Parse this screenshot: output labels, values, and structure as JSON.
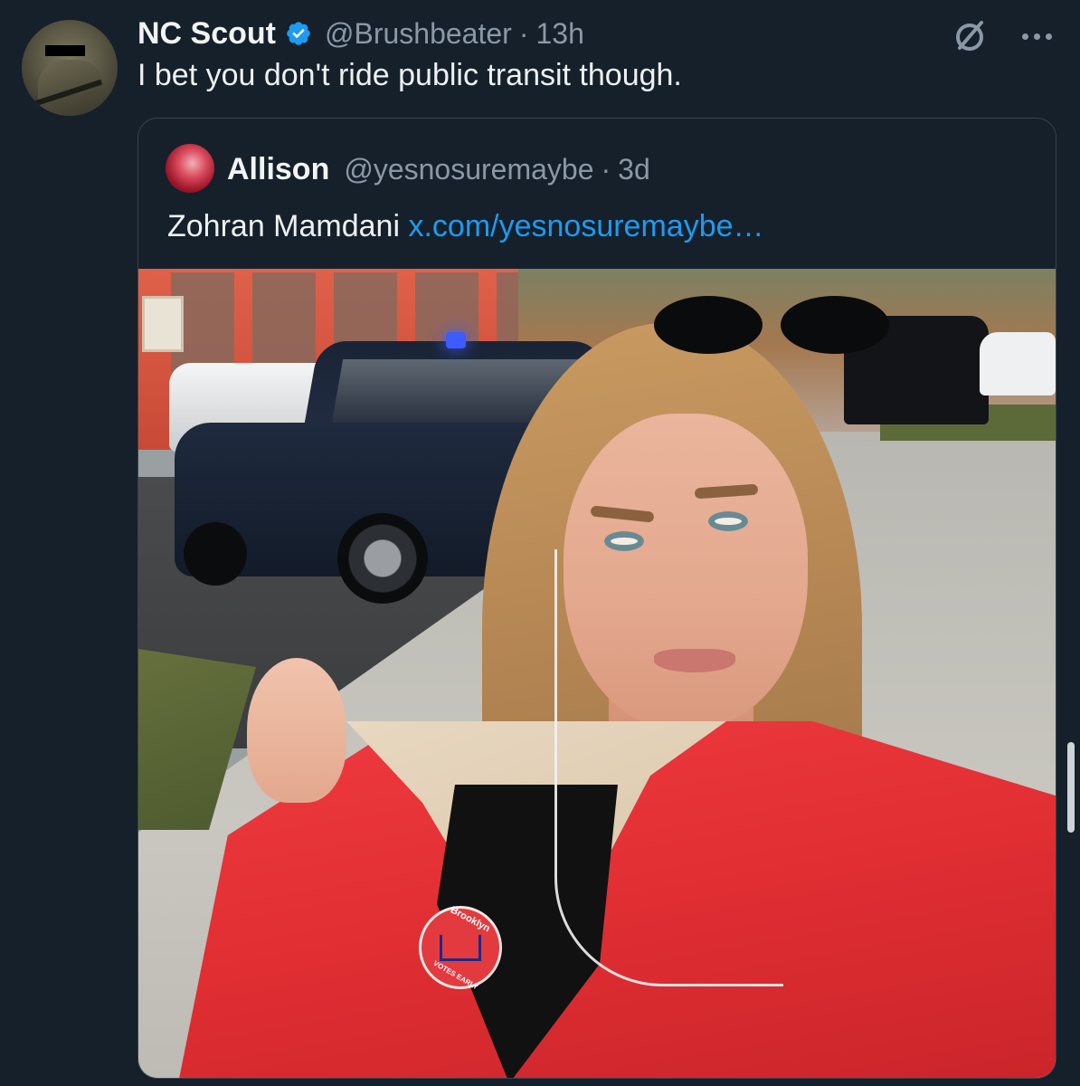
{
  "tweet": {
    "author": {
      "display_name": "NC Scout",
      "handle": "@Brushbeater",
      "verified": true,
      "avatar_icon": "user-avatar"
    },
    "separator": "·",
    "time": "13h",
    "text": "I bet you don't ride public transit though.",
    "actions": {
      "grok_icon": "grok-icon",
      "more_icon": "more-options-icon"
    }
  },
  "quoted": {
    "author": {
      "display_name": "Allison",
      "handle": "@yesnosuremaybe",
      "avatar_icon": "user-avatar"
    },
    "separator": "·",
    "time": "3d",
    "text": "Zohran Mamdani",
    "link": "x.com/yesnosuremaybe…",
    "photo": {
      "badge_top": "Brooklyn",
      "badge_bottom": "VOTES EARLY"
    }
  },
  "colors": {
    "background": "#15202b",
    "link": "#1d9bf0",
    "verified": "#1d9bf0",
    "muted": "#8b98a5"
  }
}
